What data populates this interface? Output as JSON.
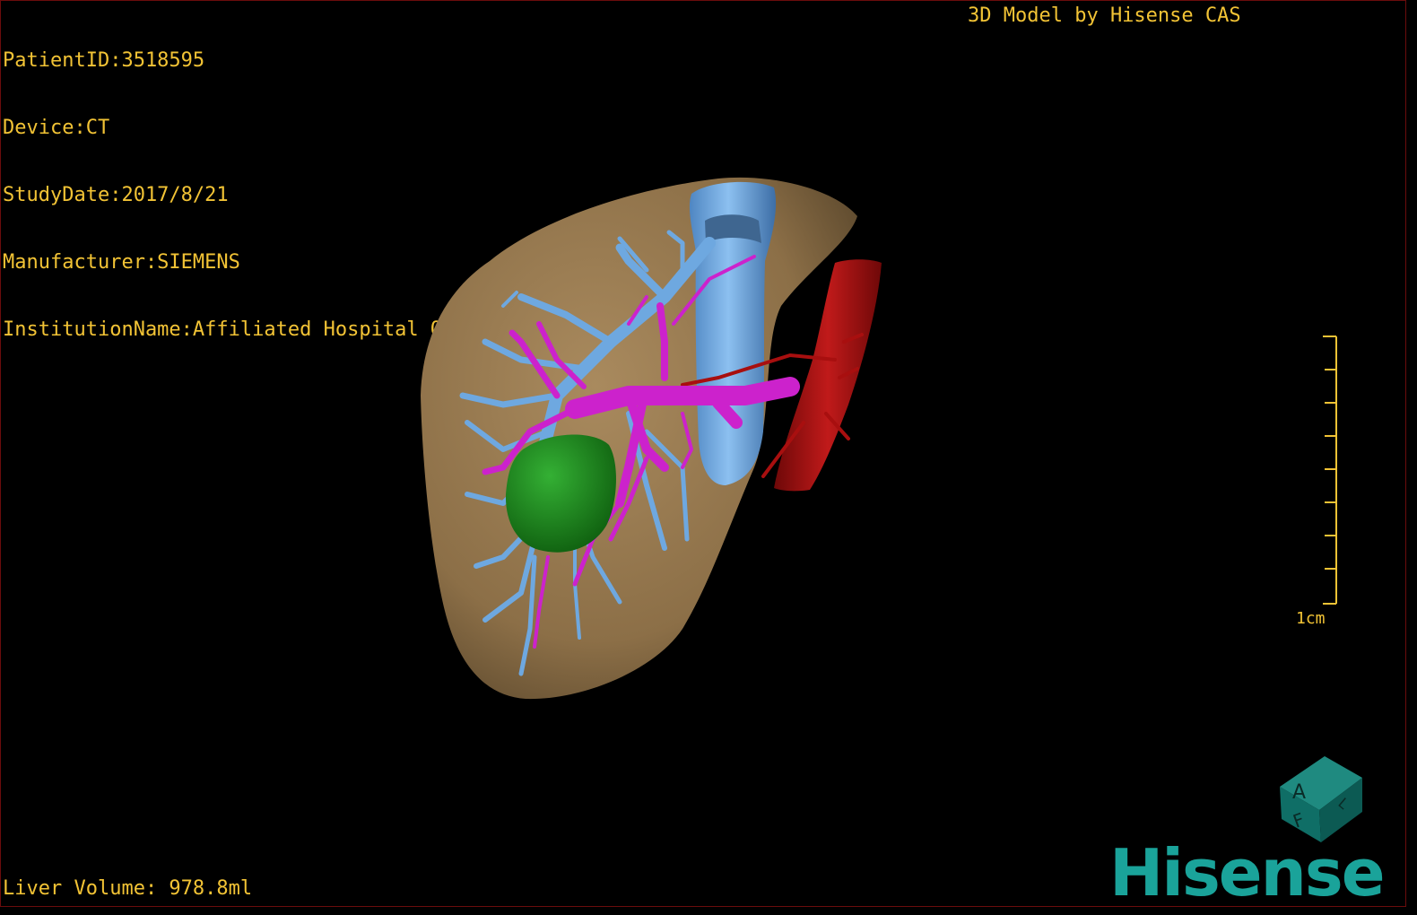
{
  "header": {
    "patient_id": "PatientID:3518595",
    "device": "Device:CT",
    "study_date": "StudyDate:2017/8/21",
    "manufacturer": "Manufacturer:SIEMENS",
    "institution": "InstitutionName:Affiliated Hospital Qingdao University-C",
    "model_by": "3D Model by Hisense CAS"
  },
  "footer": {
    "liver_volume": "Liver Volume: 978.8ml"
  },
  "scale_bar": {
    "label": "1cm",
    "color": "#f2c335"
  },
  "orientation_cube": {
    "faces": [
      "A",
      "F",
      "L"
    ],
    "color": "#0f6e66"
  },
  "logo": {
    "text": "Hisense",
    "color": "#1aa39a"
  },
  "colors": {
    "liver": "#9a7c52",
    "portal_vein": "#6ea8e0",
    "hepatic_artery": "#cc22cc",
    "tumor": "#1f8a1f",
    "aorta": "#a80f0f",
    "overlay_text": "#f2c335"
  }
}
